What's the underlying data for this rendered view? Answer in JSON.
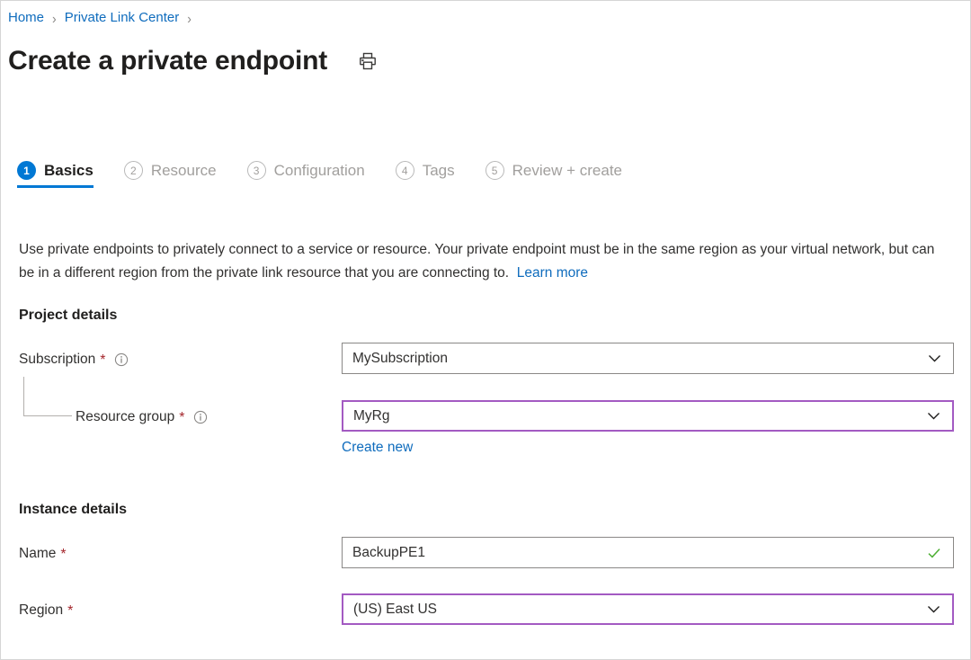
{
  "breadcrumb": {
    "items": [
      {
        "label": "Home"
      },
      {
        "label": "Private Link Center"
      }
    ],
    "separator": "›"
  },
  "header": {
    "title": "Create a private endpoint",
    "print_icon": "printer-icon"
  },
  "wizard": {
    "tabs": [
      {
        "num": "1",
        "label": "Basics",
        "active": true
      },
      {
        "num": "2",
        "label": "Resource",
        "active": false
      },
      {
        "num": "3",
        "label": "Configuration",
        "active": false
      },
      {
        "num": "4",
        "label": "Tags",
        "active": false
      },
      {
        "num": "5",
        "label": "Review + create",
        "active": false
      }
    ]
  },
  "description": {
    "text": "Use private endpoints to privately connect to a service or resource. Your private endpoint must be in the same region as your virtual network, but can be in a different region from the private link resource that you are connecting to.",
    "learn_more": "Learn more"
  },
  "project_details": {
    "heading": "Project details",
    "subscription": {
      "label": "Subscription",
      "required": "*",
      "info_icon": "info-icon",
      "value": "MySubscription",
      "chevron_icon": "chevron-down-icon"
    },
    "resource_group": {
      "label": "Resource group",
      "required": "*",
      "info_icon": "info-icon",
      "value": "MyRg",
      "chevron_icon": "chevron-down-icon",
      "create_new": "Create new"
    }
  },
  "instance_details": {
    "heading": "Instance details",
    "name": {
      "label": "Name",
      "required": "*",
      "value": "BackupPE1",
      "valid_icon": "checkmark-icon"
    },
    "region": {
      "label": "Region",
      "required": "*",
      "value": "(US) East US",
      "chevron_icon": "chevron-down-icon"
    }
  },
  "colors": {
    "link": "#0f6cbd",
    "accent": "#0078d4",
    "required": "#a4262c",
    "modified_border": "#a35ac2",
    "valid": "#4caf32",
    "inactive": "#a19f9d"
  }
}
